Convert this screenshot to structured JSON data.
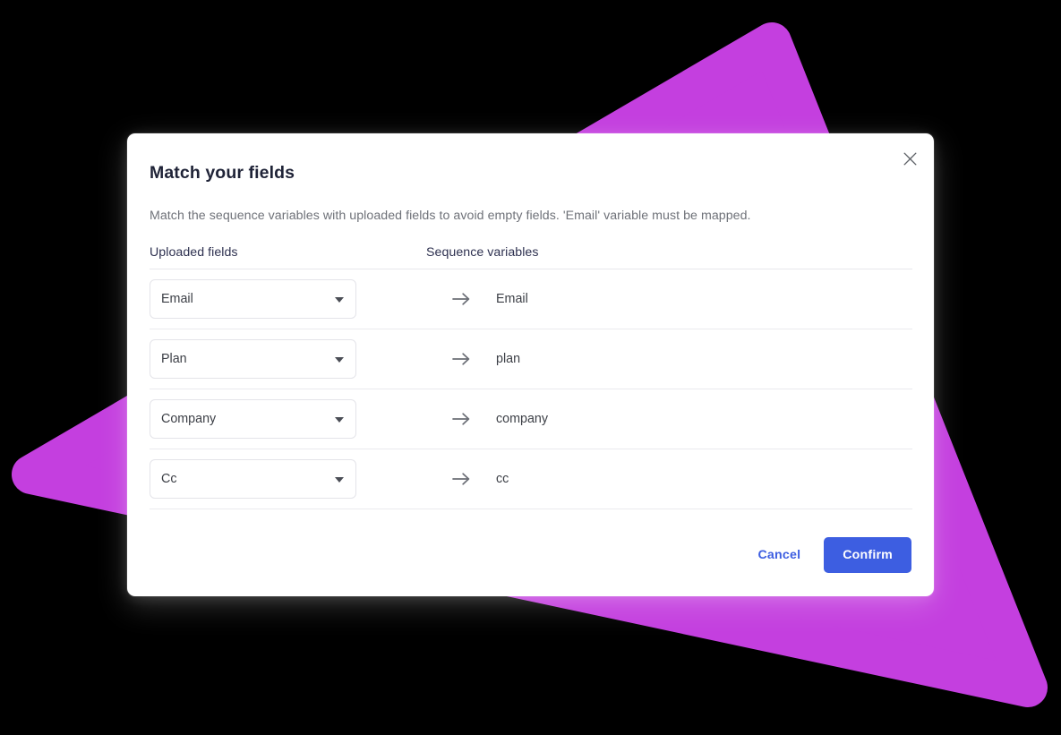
{
  "background": {
    "canvas_color": "#000000",
    "shape_color": "#c43fdf",
    "shape_name": "magenta-triangle"
  },
  "modal": {
    "title": "Match your fields",
    "description": "Match the sequence variables with uploaded fields to avoid empty fields. 'Email' variable must be mapped.",
    "close_icon": "close-icon",
    "accent_color": "#3d5ee1",
    "table": {
      "headers": {
        "uploaded": "Uploaded fields",
        "sequence": "Sequence variables"
      },
      "rows": [
        {
          "uploaded_field": "Email",
          "sequence_variable": "Email",
          "caret_icon": "chevron-down-icon",
          "arrow_icon": "arrow-right-icon"
        },
        {
          "uploaded_field": "Plan",
          "sequence_variable": "plan",
          "caret_icon": "chevron-down-icon",
          "arrow_icon": "arrow-right-icon"
        },
        {
          "uploaded_field": "Company",
          "sequence_variable": "company",
          "caret_icon": "chevron-down-icon",
          "arrow_icon": "arrow-right-icon"
        },
        {
          "uploaded_field": "Cc",
          "sequence_variable": "cc",
          "caret_icon": "chevron-down-icon",
          "arrow_icon": "arrow-right-icon"
        }
      ]
    },
    "footer": {
      "cancel_label": "Cancel",
      "confirm_label": "Confirm"
    }
  }
}
